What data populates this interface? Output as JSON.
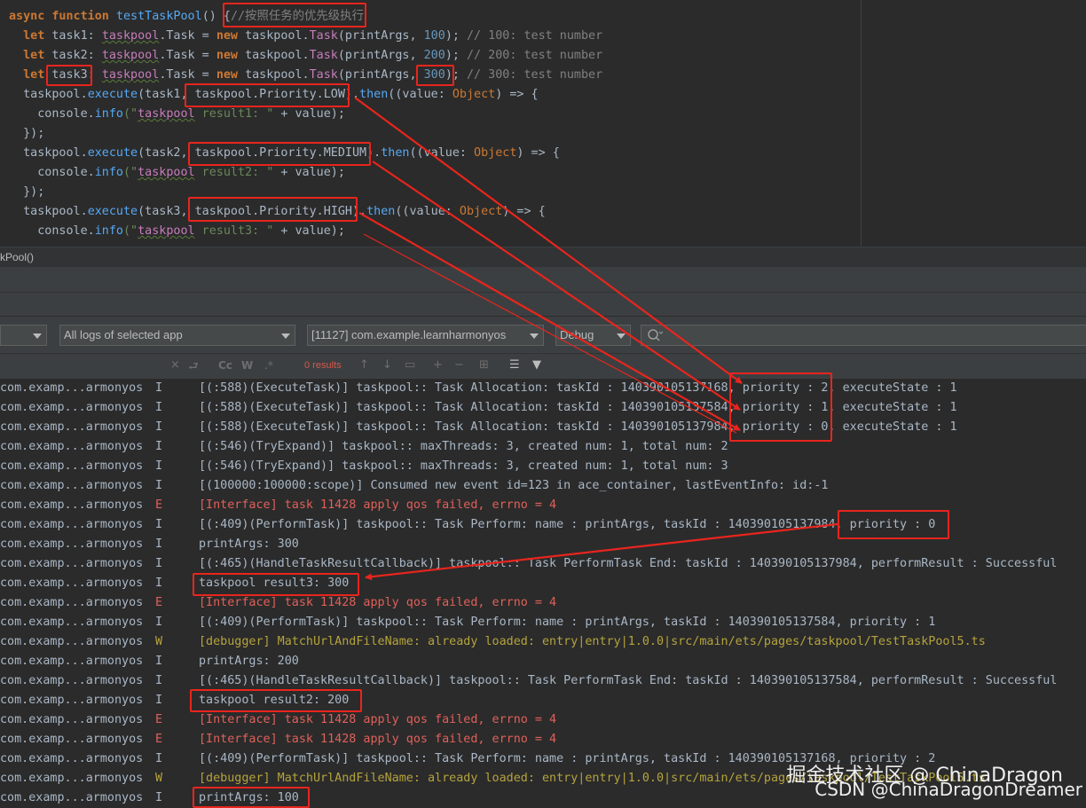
{
  "code": {
    "lines": [
      {
        "parts": [
          [
            "kw",
            "async "
          ],
          [
            "kw",
            "function "
          ],
          [
            "fn",
            "testTaskPool"
          ],
          [
            "plain",
            "() "
          ],
          [
            "plain",
            "{"
          ],
          [
            "cmt",
            "//按照任务的优先级执行"
          ]
        ]
      },
      {
        "parts": [
          [
            "plain",
            "  "
          ],
          [
            "kw",
            "let "
          ],
          [
            "plain",
            "task1: "
          ],
          [
            "ns",
            "taskpool"
          ],
          [
            "plain",
            "."
          ],
          [
            "plain",
            "Task"
          ],
          [
            "plain",
            " = "
          ],
          [
            "kw",
            "new "
          ],
          [
            "plain",
            "taskpool."
          ],
          [
            "cls",
            "Task"
          ],
          [
            "plain",
            "(printArgs, "
          ],
          [
            "num",
            "100"
          ],
          [
            "plain",
            "); "
          ],
          [
            "cmt",
            "// 100: test number"
          ]
        ]
      },
      {
        "parts": [
          [
            "plain",
            "  "
          ],
          [
            "kw",
            "let "
          ],
          [
            "plain",
            "task2: "
          ],
          [
            "ns",
            "taskpool"
          ],
          [
            "plain",
            "."
          ],
          [
            "plain",
            "Task"
          ],
          [
            "plain",
            " = "
          ],
          [
            "kw",
            "new "
          ],
          [
            "plain",
            "taskpool."
          ],
          [
            "cls",
            "Task"
          ],
          [
            "plain",
            "(printArgs, "
          ],
          [
            "num",
            "200"
          ],
          [
            "plain",
            "); "
          ],
          [
            "cmt",
            "// 200: test number"
          ]
        ]
      },
      {
        "parts": [
          [
            "plain",
            "  "
          ],
          [
            "kw",
            "let "
          ],
          [
            "plain",
            "task3: "
          ],
          [
            "ns",
            "taskpool"
          ],
          [
            "plain",
            "."
          ],
          [
            "plain",
            "Task"
          ],
          [
            "plain",
            " = "
          ],
          [
            "kw",
            "new "
          ],
          [
            "plain",
            "taskpool."
          ],
          [
            "cls",
            "Task"
          ],
          [
            "plain",
            "(printArgs, "
          ],
          [
            "num",
            "300"
          ],
          [
            "plain",
            "); "
          ],
          [
            "cmt",
            "// 300: test number"
          ]
        ]
      },
      {
        "parts": [
          [
            "plain",
            "  taskpool."
          ],
          [
            "fn",
            "execute"
          ],
          [
            "plain",
            "(task1, taskpool.Priority.LOW)."
          ],
          [
            "fn",
            "then"
          ],
          [
            "plain",
            "((value: "
          ],
          [
            "type",
            "Object"
          ],
          [
            "plain",
            ") => {"
          ]
        ]
      },
      {
        "parts": [
          [
            "plain",
            "    console."
          ],
          [
            "fn",
            "info"
          ],
          [
            "str",
            "(\""
          ],
          [
            "ns",
            "taskpool"
          ],
          [
            "str",
            " result1: \""
          ],
          [
            "plain",
            " + value);"
          ]
        ]
      },
      {
        "parts": [
          [
            "plain",
            "  });"
          ]
        ]
      },
      {
        "parts": [
          [
            "plain",
            "  taskpool."
          ],
          [
            "fn",
            "execute"
          ],
          [
            "plain",
            "(task2, taskpool.Priority.MEDIUM)."
          ],
          [
            "fn",
            "then"
          ],
          [
            "plain",
            "((value: "
          ],
          [
            "type",
            "Object"
          ],
          [
            "plain",
            ") => {"
          ]
        ]
      },
      {
        "parts": [
          [
            "plain",
            "    console."
          ],
          [
            "fn",
            "info"
          ],
          [
            "str",
            "(\""
          ],
          [
            "ns",
            "taskpool"
          ],
          [
            "str",
            " result2: \""
          ],
          [
            "plain",
            " + value);"
          ]
        ]
      },
      {
        "parts": [
          [
            "plain",
            "  });"
          ]
        ]
      },
      {
        "parts": [
          [
            "plain",
            "  taskpool."
          ],
          [
            "fn",
            "execute"
          ],
          [
            "plain",
            "(task3, taskpool.Priority.HIGH)."
          ],
          [
            "fn",
            "then"
          ],
          [
            "plain",
            "((value: "
          ],
          [
            "type",
            "Object"
          ],
          [
            "plain",
            ") => {"
          ]
        ]
      },
      {
        "parts": [
          [
            "plain",
            "    console."
          ],
          [
            "fn",
            "info"
          ],
          [
            "str",
            "(\""
          ],
          [
            "ns",
            "taskpool"
          ],
          [
            "str",
            " result3: \""
          ],
          [
            "plain",
            " + value);"
          ]
        ]
      }
    ]
  },
  "breadcrumb": {
    "text": "kPool()"
  },
  "filters": {
    "all_logs": "All logs of selected app",
    "process": "[11127] com.example.learnharmonyos",
    "level": "Debug",
    "search_placeholder": ""
  },
  "log_toolbar": {
    "results": "0 results",
    "cc": "Cc",
    "w": "W",
    "regex": ".*"
  },
  "logs": [
    {
      "tag": "com.examp...armonyos",
      "level": "I",
      "msg": "[(:588)(ExecuteTask)] taskpool:: Task Allocation: taskId : 140390105137168, priority : 2, executeState : 1"
    },
    {
      "tag": "com.examp...armonyos",
      "level": "I",
      "msg": "[(:588)(ExecuteTask)] taskpool:: Task Allocation: taskId : 140390105137584, priority : 1, executeState : 1"
    },
    {
      "tag": "com.examp...armonyos",
      "level": "I",
      "msg": "[(:588)(ExecuteTask)] taskpool:: Task Allocation: taskId : 140390105137984, priority : 0, executeState : 1"
    },
    {
      "tag": "com.examp...armonyos",
      "level": "I",
      "msg": "[(:546)(TryExpand)] taskpool:: maxThreads: 3, created num: 1, total num: 2"
    },
    {
      "tag": "com.examp...armonyos",
      "level": "I",
      "msg": "[(:546)(TryExpand)] taskpool:: maxThreads: 3, created num: 1, total num: 3"
    },
    {
      "tag": "com.examp...armonyos",
      "level": "I",
      "msg": "[(100000:100000:scope)] Consumed new event id=123 in ace_container, lastEventInfo: id:-1"
    },
    {
      "tag": "com.examp...armonyos",
      "level": "E",
      "msg": "[Interface] task 11428 apply qos failed, errno = 4"
    },
    {
      "tag": "com.examp...armonyos",
      "level": "I",
      "msg": "[(:409)(PerformTask)] taskpool:: Task Perform: name : printArgs, taskId : 140390105137984, priority : 0"
    },
    {
      "tag": "com.examp...armonyos",
      "level": "I",
      "msg": "printArgs: 300"
    },
    {
      "tag": "com.examp...armonyos",
      "level": "I",
      "msg": "[(:465)(HandleTaskResultCallback)] taskpool:: Task PerformTask End: taskId : 140390105137984, performResult : Successful"
    },
    {
      "tag": "com.examp...armonyos",
      "level": "I",
      "msg": "taskpool result3: 300"
    },
    {
      "tag": "com.examp...armonyos",
      "level": "E",
      "msg": "[Interface] task 11428 apply qos failed, errno = 4"
    },
    {
      "tag": "com.examp...armonyos",
      "level": "I",
      "msg": "[(:409)(PerformTask)] taskpool:: Task Perform: name : printArgs, taskId : 140390105137584, priority : 1"
    },
    {
      "tag": "com.examp...armonyos",
      "level": "W",
      "msg": "[debugger] MatchUrlAndFileName: already loaded: entry|entry|1.0.0|src/main/ets/pages/taskpool/TestTaskPool5.ts"
    },
    {
      "tag": "com.examp...armonyos",
      "level": "I",
      "msg": "printArgs: 200"
    },
    {
      "tag": "com.examp...armonyos",
      "level": "I",
      "msg": "[(:465)(HandleTaskResultCallback)] taskpool:: Task PerformTask End: taskId : 140390105137584, performResult : Successful"
    },
    {
      "tag": "com.examp...armonyos",
      "level": "I",
      "msg": "taskpool result2: 200"
    },
    {
      "tag": "com.examp...armonyos",
      "level": "E",
      "msg": "[Interface] task 11428 apply qos failed, errno = 4"
    },
    {
      "tag": "com.examp...armonyos",
      "level": "E",
      "msg": "[Interface] task 11428 apply qos failed, errno = 4"
    },
    {
      "tag": "com.examp...armonyos",
      "level": "I",
      "msg": "[(:409)(PerformTask)] taskpool:: Task Perform: name : printArgs, taskId : 140390105137168, priority : 2"
    },
    {
      "tag": "com.examp...armonyos",
      "level": "W",
      "msg": "[debugger] MatchUrlAndFileName: already loaded: entry|entry|1.0.0|src/main/ets/pages/taskpool/TestTaskPool5.ts"
    },
    {
      "tag": "com.examp...armonyos",
      "level": "I",
      "msg": "printArgs: 100"
    }
  ],
  "colors": {
    "error": "#e0605a",
    "warn": "#b5a33d",
    "info": "#a9b7c6",
    "highlight": "#e8251d"
  },
  "watermark": {
    "line1": "掘金技术社区 @ ChinaDragon",
    "line2": "CSDN @ChinaDragonDreamer"
  }
}
